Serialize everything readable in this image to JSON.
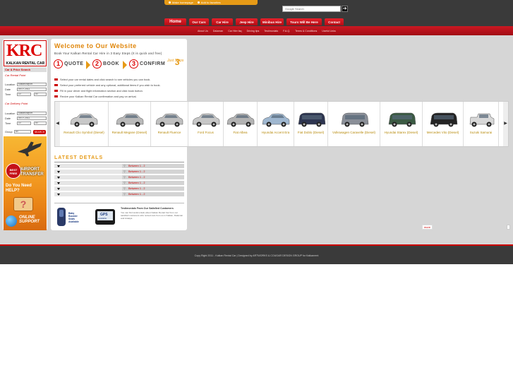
{
  "toplinks": {
    "homepage": "Make homepage",
    "favorites": "Add to favorites"
  },
  "search": {
    "placeholder": "Google Search",
    "button": "➔"
  },
  "nav": [
    "Home",
    "Our Cars",
    "Car Hire",
    "Jeep Hire",
    "Minibus Hire",
    "Tours Will Be Here",
    "Contact"
  ],
  "subnav": [
    "About Us",
    "Dalaman",
    "Car Hire faq",
    "Driving tips",
    "Testimonials",
    "F.A.Q.",
    "Terms & Conditions",
    "Useful Links"
  ],
  "logo": {
    "letters": "KRC",
    "text": "KALKAN RENTAL CAR"
  },
  "sidebar": {
    "car_price_search": "Car & Price Search",
    "car_rental_point": "Car Rental Point",
    "location_label": "Location",
    "location_value": "Kalkan/Airport",
    "date_label": "Date",
    "date_value": "09-07-2011",
    "time_label": "Time",
    "hour_value": "10",
    "minute_value": "00",
    "delivery_point": "Car Delivery Point",
    "group_label": "Group",
    "group_value": "All",
    "search_button": "SEARCH"
  },
  "promo": {
    "free_badge": "BEST FREE",
    "airport": "AIRPORT TRANSFER",
    "need_help": "Do You Need HELP?",
    "online": "ONLINE SUPPORT"
  },
  "main": {
    "welcome": "Welcome to Our Website",
    "intro": "Book Your Kalkan Rental Car Hire in 3 Easy Steps (It is quick and free)",
    "steps": [
      "QUOTE",
      "BOOK",
      "CONFIRM"
    ],
    "step_nums": [
      "1",
      "2",
      "3"
    ],
    "just_steps": "Just Steps",
    "just_num": "3",
    "bullets": [
      "Select your car rental dates and click search to see vehicles you can book.",
      "Select your preferred vehicle and any optional, additional items if you wish to book.",
      "Fill in your driver and flight information section and click book button.",
      "Recive your Kalkan Rental Car confirmation and pay on arrival."
    ]
  },
  "cars": [
    "Renault Clio Symbol (Diesel)",
    "Renault Megane (Diesel)",
    "Renault Fluence",
    "Ford Focus",
    "Fiat Albea",
    "Hyundai Accent Era",
    "Fiat Doblo (Diesel)",
    "Volkswagen Caravelle (Diesel)",
    "Hyundai Starex (Diesel)",
    "Mercedes Vito (Diesel)",
    "Suzuki Samurai"
  ],
  "carousel": {
    "prev": "◀",
    "next": "▶"
  },
  "latest": {
    "title": "LATEST DETALS",
    "items": [
      "Between 1 - 2",
      "Between 1 - 2",
      "Between 1 - 2",
      "Between 1 - 2",
      "Between 1 - 2",
      "Between 1 - 2"
    ]
  },
  "booster": {
    "image_text": "Baby Booster Seats Available",
    "gps_text": "GPS Available",
    "title": "Testimonials From Our Satisfied Customers",
    "body": "You can find testimonials about Kalkan Rental Car from our satisfied customers who rented cars from us in Kalkan, Dalaman and Antalya."
  },
  "more_label": "more",
  "footer": {
    "text": "Copy Right 2011 - Kalkan Rental Car   |   Designed by ARTWORKS & COUGAR DESIGN GROUP for Kalkanrent"
  }
}
